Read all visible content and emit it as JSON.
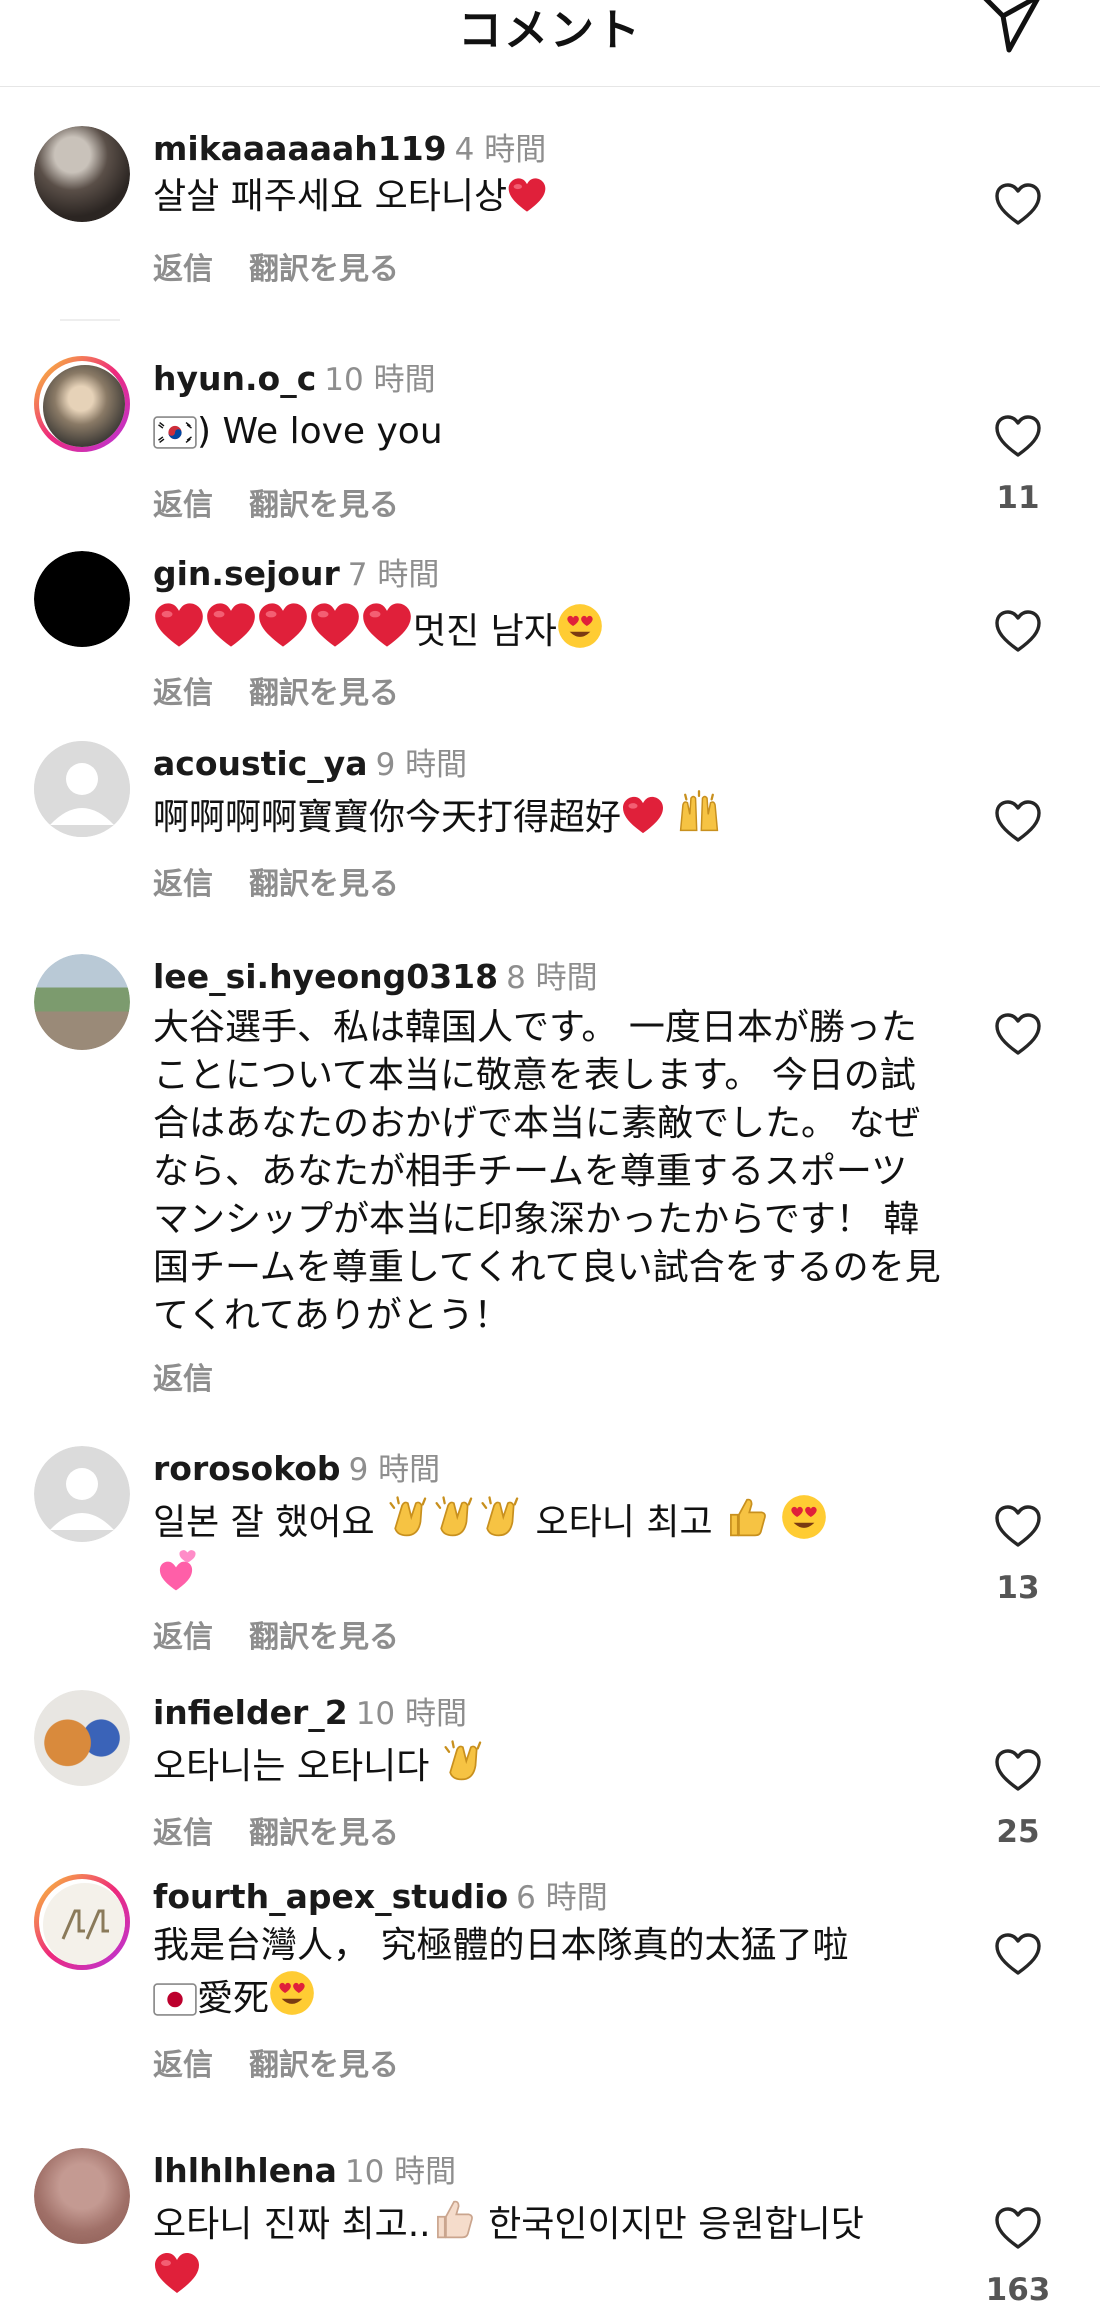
{
  "header": {
    "title": "コメント"
  },
  "actions": {
    "reply": "返信",
    "translate": "翻訳を見る"
  },
  "comments": [
    {
      "username": "mikaaaaaah119",
      "time": "4 時間",
      "text": "살살 패주세요 오타니상",
      "like_count": ""
    },
    {
      "username": "hyun.o_c",
      "time": "10 時間",
      "text": ") We love you",
      "like_count": "11"
    },
    {
      "username": "gin.sejour",
      "time": "7 時間",
      "text": "멋진 남자",
      "like_count": ""
    },
    {
      "username": "acoustic_ya",
      "time": "9 時間",
      "text": "啊啊啊啊寶寶你今天打得超好",
      "like_count": ""
    },
    {
      "username": "lee_si.hyeong0318",
      "time": "8 時間",
      "text": "大谷選手、私は韓国人です。 一度日本が勝ったことについて本当に敬意を表します。 今日の試合はあなたのおかげで本当に素敵でした。 なぜなら、あなたが相手チームを尊重するスポーツマンシップが本当に印象深かったからです！ 韓国チームを尊重してくれて良い試合をするのを見てくれてありがとう！",
      "like_count": ""
    },
    {
      "username": "rorosokob",
      "time": "9 時間",
      "text": "일본 잘 했어요",
      "text2": "오타니 최고",
      "like_count": "13"
    },
    {
      "username": "infielder_2",
      "time": "10 時間",
      "text": "오타니는 오타니다",
      "like_count": "25"
    },
    {
      "username": "fourth_apex_studio",
      "time": "6 時間",
      "text": "我是台灣人， 究極體的日本隊真的太猛了啦",
      "text2": "愛死",
      "like_count": ""
    },
    {
      "username": "lhlhlhlena",
      "time": "10 時間",
      "text": "오타니 진짜 최고..",
      "text2": "한국인이지만 응원합니닷",
      "like_count": "163"
    }
  ],
  "colors": {
    "heart": "#e0203a",
    "muted": "#8e8e8e"
  }
}
